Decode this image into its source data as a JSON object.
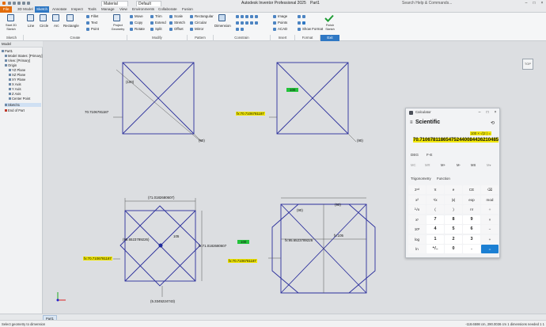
{
  "app": {
    "title": "Autodesk Inventor Professional 2025",
    "document": "Part1",
    "material": "Material",
    "appearance": "Default",
    "search_placeholder": "Search Help & Commands..."
  },
  "tabs": [
    "File",
    "3D Model",
    "Sketch",
    "Annotate",
    "Inspect",
    "Tools",
    "Manage",
    "View",
    "Environments",
    "Collaborate",
    "Fusion"
  ],
  "ribbon": {
    "sketch_group": {
      "label": "Sketch",
      "start_2d": "Start 2D Sketch",
      "finish": "Finish Sketch"
    },
    "create_group": {
      "label": "Create",
      "items": [
        "Line",
        "Circle",
        "Arc",
        "Rectangle",
        "Fillet",
        "Text",
        "Point"
      ]
    },
    "project_geometry": "Project Geometry",
    "modify_group": {
      "label": "Modify",
      "items": [
        "Move",
        "Trim",
        "Scale",
        "Copy",
        "Extend",
        "Stretch",
        "Rotate",
        "Split",
        "Offset"
      ]
    },
    "pattern_group": {
      "label": "Pattern",
      "items": [
        "Rectangular",
        "Circular",
        "Mirror"
      ]
    },
    "constrain_group": {
      "label": "Constrain",
      "dimension": "Dimension"
    },
    "insert_group": {
      "label": "Insert",
      "items": [
        "Image",
        "Points",
        "ACAD"
      ]
    },
    "format_group": {
      "label": "Format",
      "show_format": "Show Format"
    },
    "exit_group": {
      "label": "Exit",
      "finish": "Finish Sketch"
    }
  },
  "browser": {
    "header": "Model",
    "items": [
      "Part1",
      "Model States: [Primary]",
      "View: [Primary]",
      "Origin",
      "YZ Plane",
      "XZ Plane",
      "XY Plane",
      "X Axis",
      "Y Axis",
      "Z Axis",
      "Center Point",
      "Sketch1",
      "End of Part"
    ],
    "selected": "Sketch1"
  },
  "canvas": {
    "viewcube": "TOP",
    "dims": {
      "d1": "(100)",
      "d2": "70.7106781187",
      "d3": "(90)",
      "d4": "100",
      "d5": "fx:70.7106781187",
      "d6": "(90)",
      "d7": "(71.0182680607)",
      "d8": "(95.6523789226)",
      "d9": "105",
      "d10": "fx:71.0182680607",
      "d11": "fx:70.7106781187",
      "d12": "(5.3345224743)",
      "d13": "(90)",
      "d14": "(90)",
      "d15": "100",
      "d16": "fx:95.6523789226",
      "d17": "fx:105",
      "d18": "fx:70.7106781187"
    }
  },
  "calculator": {
    "title": "Calculator",
    "mode": "Scientific",
    "expression": "100 × √(2 ) =",
    "result": "70.710678118654752440084436210485",
    "angle": "DEG",
    "fe": "F-E",
    "memory": [
      "MC",
      "MR",
      "M+",
      "M-",
      "MS",
      "M▾"
    ],
    "trig": "Trigonometry",
    "func": "Function",
    "keys": [
      [
        "2ⁿᵈ",
        "π",
        "e",
        "CE",
        "⌫"
      ],
      [
        "x²",
        "¹/x",
        "|x|",
        "exp",
        "mod"
      ],
      [
        "²√x",
        "(",
        ")",
        "n!",
        "÷"
      ],
      [
        "xʸ",
        "7",
        "8",
        "9",
        "×"
      ],
      [
        "10ˣ",
        "4",
        "5",
        "6",
        "−"
      ],
      [
        "log",
        "1",
        "2",
        "3",
        "+"
      ],
      [
        "ln",
        "⁺/₋",
        "0",
        ".",
        "="
      ]
    ]
  },
  "doc_tabs": [
    "Part1"
  ],
  "status": {
    "left": "Select geometry to dimension",
    "right": "-118.6598 cm, 290.0036 cm   1 dimensions needed   1   1"
  }
}
